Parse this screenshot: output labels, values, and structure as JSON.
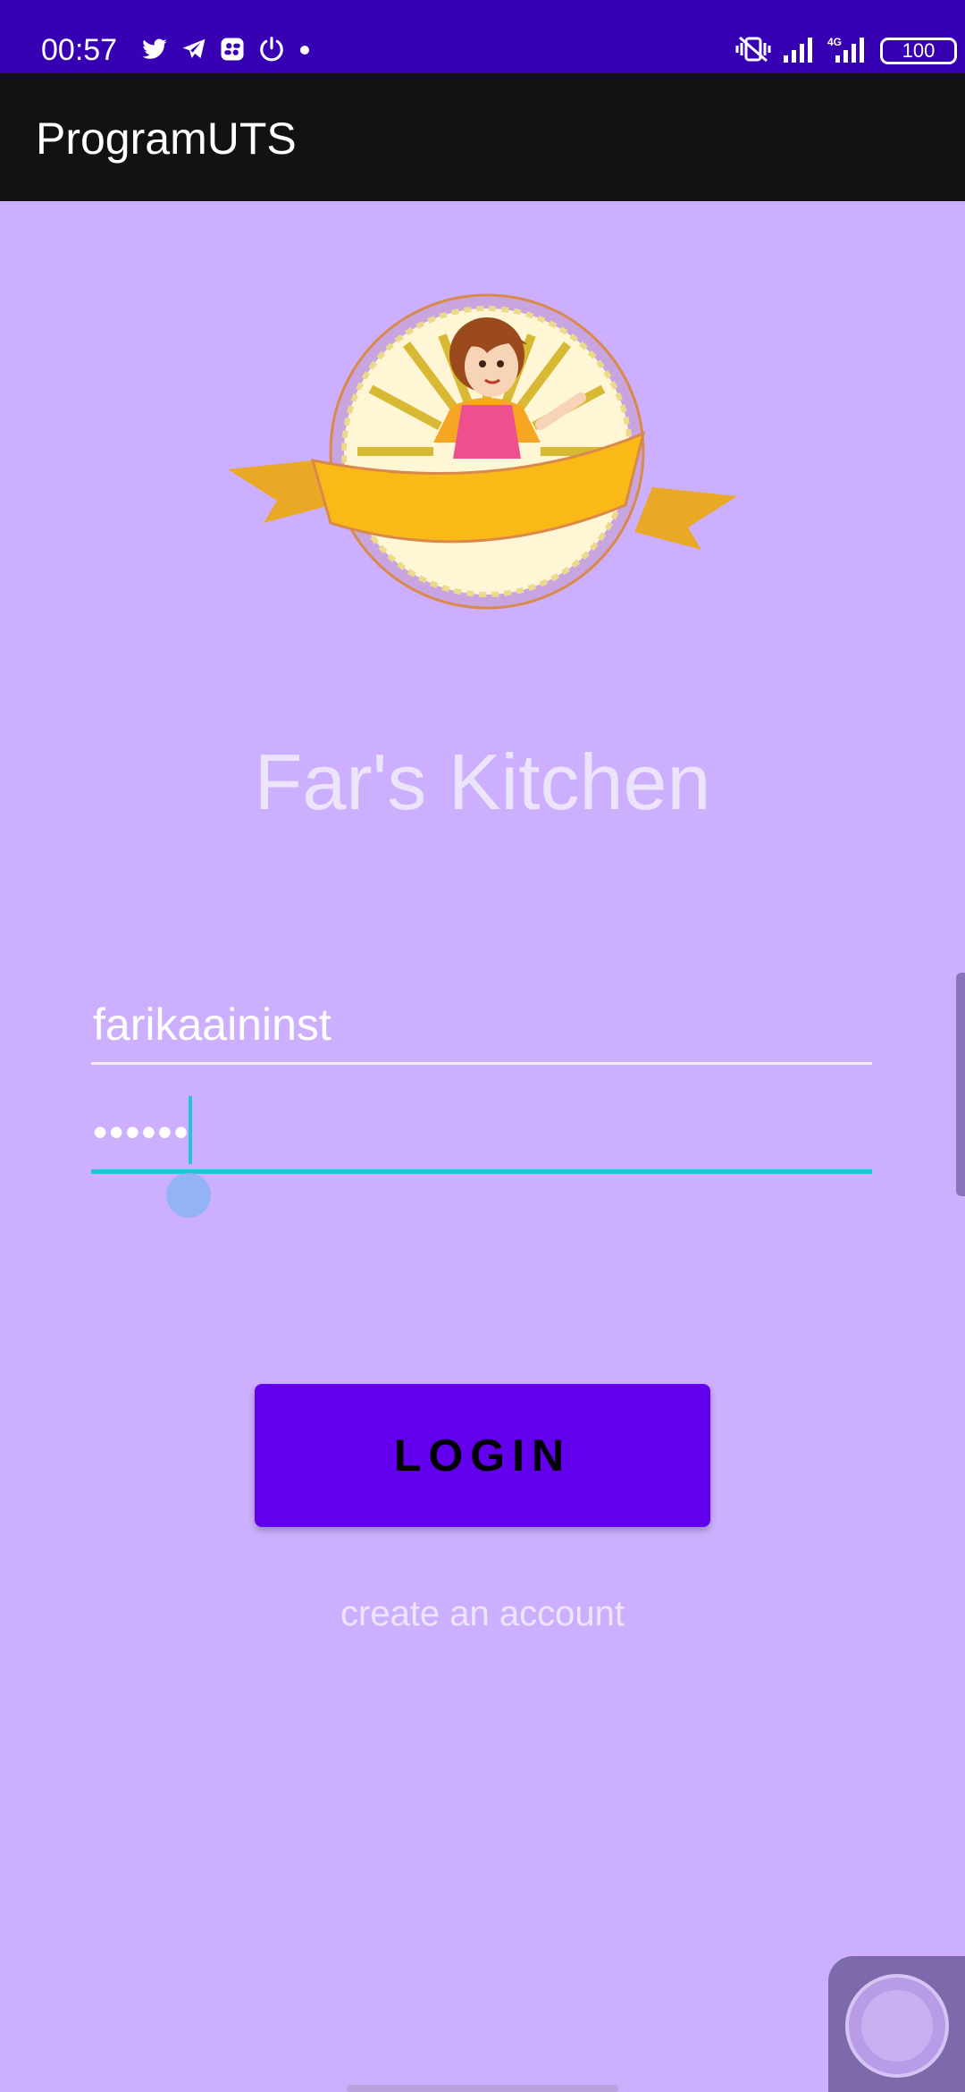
{
  "status_bar": {
    "time": "00:57",
    "battery": "100",
    "network": "4G",
    "icons": [
      "twitter-icon",
      "telegram-icon",
      "screen-record-icon",
      "power-icon",
      "dot-icon",
      "vibrate-icon",
      "signal-icon",
      "signal-4g-icon",
      "battery-icon"
    ]
  },
  "app_bar": {
    "title": "ProgramUTS"
  },
  "headline": "Far's Kitchen",
  "login_form": {
    "username_value": "farikaaininst",
    "password_value": "••••••",
    "login_label": "LOGIN",
    "create_account_label": "create an account"
  },
  "colors": {
    "background": "#ccb0ff",
    "status_bar": "#3700b3",
    "app_bar": "#121212",
    "button": "#6200ee",
    "focus_accent": "#1fc7d6"
  }
}
